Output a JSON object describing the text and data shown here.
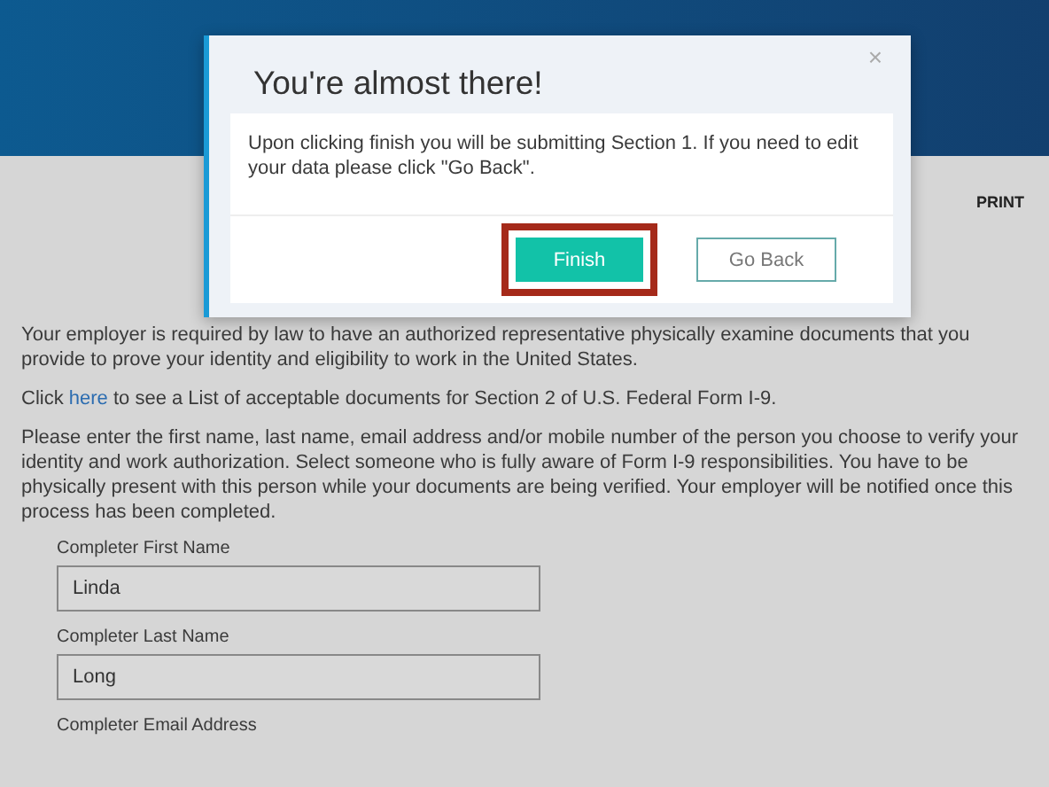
{
  "page": {
    "print_label": "PRINT",
    "paragraphs": [
      {
        "text": "Your employer is required by law to have an authorized representative physically examine documents that you provide to prove your identity and eligibility to work in the United States."
      },
      {
        "before": "Click ",
        "link": "here",
        "after": " to see a List of acceptable documents for Section 2 of U.S. Federal Form I-9."
      },
      {
        "text": "Please enter the first name, last name, email address and/or mobile number of the person you choose to verify your identity and work authorization. Select someone who is fully aware of Form I-9 responsibilities. You have to be physically present with this person while your documents are being verified. Your employer will be notified once this process has been completed."
      }
    ],
    "fields": [
      {
        "label": "Completer First Name",
        "value": "Linda"
      },
      {
        "label": "Completer Last Name",
        "value": "Long"
      },
      {
        "label": "Completer Email Address"
      }
    ]
  },
  "dialog": {
    "title": "You're almost there!",
    "close": "×",
    "message": "Upon clicking finish you will be submitting Section 1. If you need to edit your data please click \"Go Back\".",
    "buttons": [
      {
        "label": "Finish",
        "kind": "primary",
        "highlighted": true
      },
      {
        "label": "Go Back",
        "kind": "secondary",
        "highlighted": false
      }
    ]
  }
}
